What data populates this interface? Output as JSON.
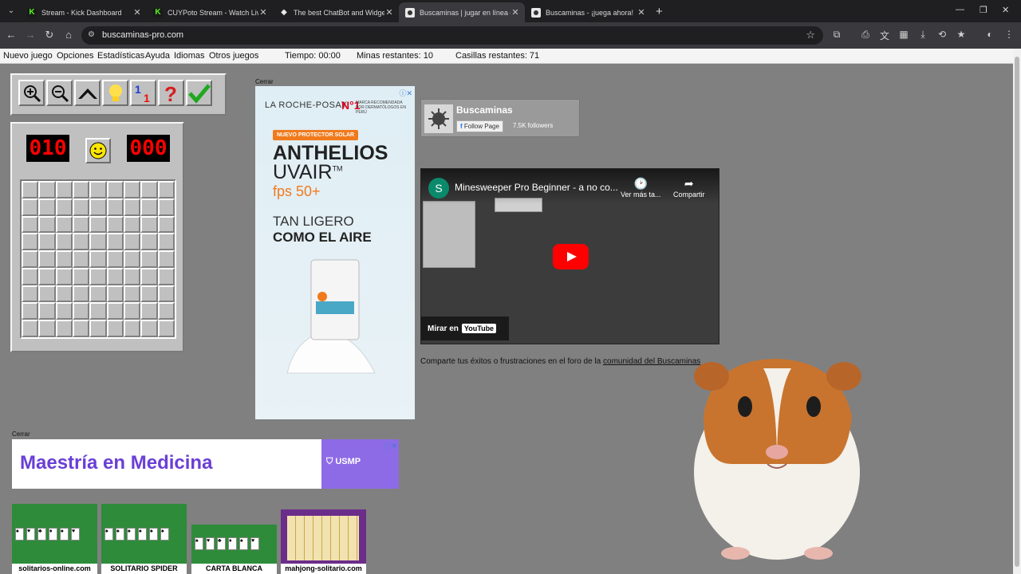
{
  "browser": {
    "tabs": [
      {
        "title": "Stream - Kick Dashboard",
        "icon": "kick-icon",
        "active": false
      },
      {
        "title": "CUYPoto Stream - Watch Live o",
        "icon": "kick-icon",
        "active": false
      },
      {
        "title": "The best ChatBot and Widgets",
        "icon": "gem-icon",
        "active": false
      },
      {
        "title": "Buscaminas | jugar en línea gra",
        "icon": "mine-icon",
        "active": true
      },
      {
        "title": "Buscaminas - ¡juega ahora!",
        "icon": "mine-icon",
        "active": false
      }
    ],
    "url": "buscaminas-pro.com"
  },
  "menu": {
    "new_game": "Nuevo juego",
    "options": "Opciones",
    "stats": "Estadísticas",
    "help": "Ayuda",
    "languages": "Idiomas",
    "other_games": "Otros juegos",
    "time": "Tiempo: 00:00",
    "mines_left": "Minas restantes: 10",
    "cells_left": "Casillas restantes: 71"
  },
  "game": {
    "mine_counter": "010",
    "timer": "000",
    "rows": 9,
    "cols": 9,
    "tools": [
      "zoom-in-icon",
      "zoom-out-icon",
      "hat-icon",
      "hint-bulb-icon",
      "numbers-icon",
      "question-icon",
      "check-icon"
    ]
  },
  "ads": {
    "close_label": "Cerrar",
    "close_label_2": "Cerrar",
    "vertical": {
      "brand": "LA ROCHE-POSAY",
      "brand_sub": "LABORATOIRE DERMATOLOGIQUE",
      "rank": "N°1",
      "rank_text": "MARCA RECOMENDADA POR DERMATÓLOGOS EN PERÚ",
      "tag": "NUEVO PROTECTOR SOLAR",
      "product": "ANTHELIOS",
      "product_line": "UVAIR",
      "tm": "TM",
      "fps": "fps 50+",
      "line1": "TAN LIGERO",
      "line2": "COMO EL AIRE"
    },
    "horizontal": {
      "text": "Maestría en Medicina",
      "logo": "USMP"
    }
  },
  "facebook": {
    "name": "Buscaminas",
    "follow": "Follow Page",
    "followers": "7.5K followers"
  },
  "video": {
    "channel_initial": "S",
    "title": "Minesweeper Pro Beginner - a no co...",
    "watch_later": "Ver más ta...",
    "share": "Compartir",
    "watch_on": "Mirar en",
    "youtube": "YouTube"
  },
  "forum": {
    "text": "Comparte tus éxitos o frustraciones en el foro de la",
    "link": "comunidad del Buscaminas"
  },
  "games": [
    {
      "label": "solitarios-online.com",
      "bg": "#2e8b3a"
    },
    {
      "label": "SOLITARIO SPIDER",
      "bg": "#2e8b3a"
    },
    {
      "label": "CARTA BLANCA",
      "bg": "#2e8b3a"
    },
    {
      "label": "mahjong-solitario.com",
      "bg": "#6b2d8a"
    }
  ]
}
